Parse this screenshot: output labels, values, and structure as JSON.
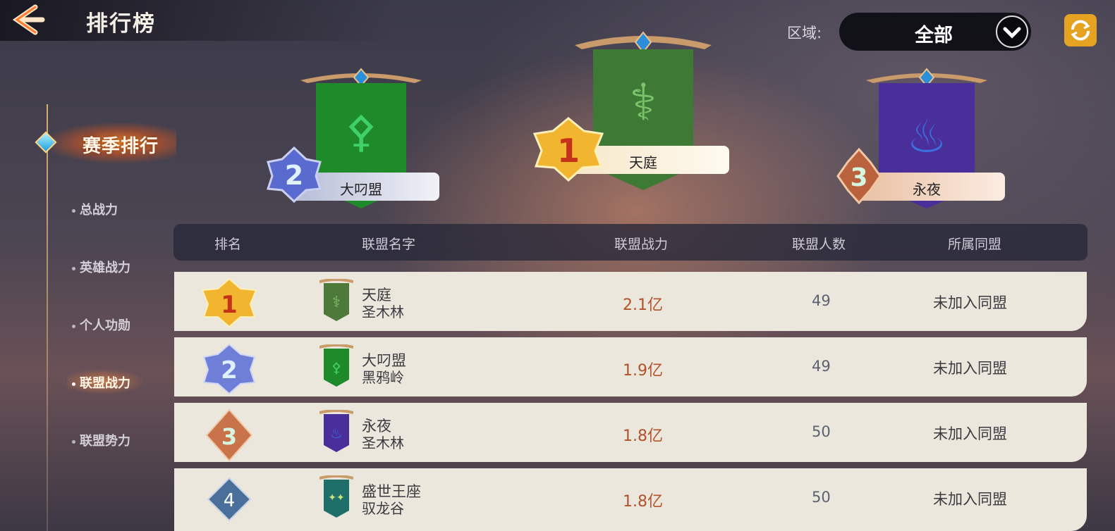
{
  "header": {
    "title": "排行榜",
    "region_label": "区域:",
    "region_value": "全部"
  },
  "sidebar": {
    "season_tab": "赛季排行",
    "items": [
      {
        "label": "总战力",
        "active": false
      },
      {
        "label": "英雄战力",
        "active": false
      },
      {
        "label": "个人功勋",
        "active": false
      },
      {
        "label": "联盟战力",
        "active": true
      },
      {
        "label": "联盟势力",
        "active": false
      }
    ]
  },
  "podium": [
    {
      "rank": "2",
      "name": "大叼盟",
      "banner_color": "#1f8a2a"
    },
    {
      "rank": "1",
      "name": "天庭",
      "banner_color": "#3e7a36"
    },
    {
      "rank": "3",
      "name": "永夜",
      "banner_color": "#4a2f9a"
    }
  ],
  "table": {
    "headers": [
      "排名",
      "联盟名字",
      "联盟战力",
      "联盟人数",
      "所属同盟"
    ],
    "rows": [
      {
        "rank": "1",
        "name": "天庭",
        "server": "圣木林",
        "power": "2.1亿",
        "members": "49",
        "alliance": "未加入同盟",
        "flag_color": "#4d7a3a"
      },
      {
        "rank": "2",
        "name": "大叼盟",
        "server": "黑鸦岭",
        "power": "1.9亿",
        "members": "49",
        "alliance": "未加入同盟",
        "flag_color": "#1f8a2a"
      },
      {
        "rank": "3",
        "name": "永夜",
        "server": "圣木林",
        "power": "1.8亿",
        "members": "50",
        "alliance": "未加入同盟",
        "flag_color": "#4a2f9a"
      },
      {
        "rank": "4",
        "name": "盛世王座",
        "server": "驭龙谷",
        "power": "1.8亿",
        "members": "50",
        "alliance": "未加入同盟",
        "flag_color": "#1e6f6a"
      }
    ]
  },
  "colors": {
    "gold": "#f2b530",
    "silver": "#6f7fd8",
    "bronze": "#c8734a",
    "accent": "#e6a322"
  }
}
